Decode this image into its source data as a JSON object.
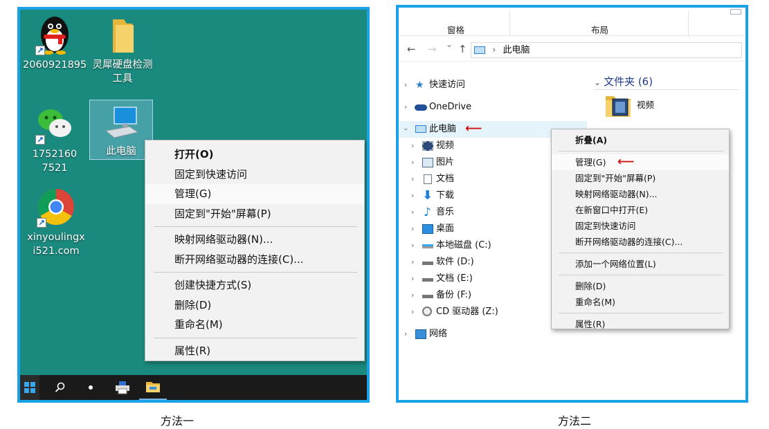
{
  "panel1": {
    "icons": [
      {
        "label": "2060921895",
        "icon": "qq-penguin-icon"
      },
      {
        "label": "灵犀硬盘检测工具",
        "icon": "folder-icon"
      },
      {
        "label": "17521607521",
        "icon": "wechat-icon"
      },
      {
        "label": "此电脑",
        "icon": "computer-icon"
      },
      {
        "label": "xinyoulingxi521.com",
        "icon": "chrome-icon"
      }
    ],
    "context_menu": {
      "open": "打开(O)",
      "pin_quick_access": "固定到快速访问",
      "manage": "管理(G)",
      "pin_start": "固定到\"开始\"屏幕(P)",
      "map_drive": "映射网络驱动器(N)...",
      "disconnect_drive": "断开网络驱动器的连接(C)...",
      "create_shortcut": "创建快捷方式(S)",
      "delete": "删除(D)",
      "rename": "重命名(M)",
      "properties": "属性(R)"
    },
    "taskbar": [
      "windows-start-icon",
      "search-icon",
      "pinwheel-app-icon",
      "printer-icon",
      "file-explorer-icon"
    ],
    "caption": "方法一"
  },
  "panel2": {
    "ribbon": {
      "pane": "窗格",
      "layout": "布局"
    },
    "nav": {
      "back": "←",
      "forward": "→",
      "dropdown": "⌄",
      "up": "↑"
    },
    "address": {
      "computer": "此电脑",
      "sep": "›"
    },
    "tree": [
      {
        "label": "快速访问",
        "icon": "star-icon"
      },
      {
        "label": "OneDrive",
        "icon": "cloud-icon"
      },
      {
        "label": "此电脑",
        "icon": "computer-icon"
      },
      {
        "label": "视频",
        "icon": "video-icon"
      },
      {
        "label": "图片",
        "icon": "picture-icon"
      },
      {
        "label": "文档",
        "icon": "document-icon"
      },
      {
        "label": "下载",
        "icon": "download-icon"
      },
      {
        "label": "音乐",
        "icon": "music-icon"
      },
      {
        "label": "桌面",
        "icon": "desktop-icon"
      },
      {
        "label": "本地磁盘 (C:)",
        "icon": "drive-c-icon"
      },
      {
        "label": "软件 (D:)",
        "icon": "drive-icon"
      },
      {
        "label": "文档 (E:)",
        "icon": "drive-icon"
      },
      {
        "label": "备份 (F:)",
        "icon": "drive-icon"
      },
      {
        "label": "CD 驱动器 (Z:)",
        "icon": "cd-drive-icon"
      },
      {
        "label": "网络",
        "icon": "network-icon"
      }
    ],
    "content": {
      "section": "文件夹 (6)",
      "folder": "视频"
    },
    "context_menu": {
      "collapse": "折叠(A)",
      "manage": "管理(G)",
      "pin_start": "固定到\"开始\"屏幕(P)",
      "map_drive": "映射网络驱动器(N)...",
      "open_new_window": "在新窗口中打开(E)",
      "pin_quick_access": "固定到快速访问",
      "disconnect_drive": "断开网络驱动器的连接(C)...",
      "add_network_location": "添加一个网络位置(L)",
      "delete": "删除(D)",
      "rename": "重命名(M)",
      "properties": "属性(R)"
    },
    "caption": "方法二"
  },
  "colors": {
    "desktop": "#1b8a7e",
    "frame": "#1aa1e8",
    "arrow": "#d01010",
    "taskbar": "#1a1a1a"
  }
}
